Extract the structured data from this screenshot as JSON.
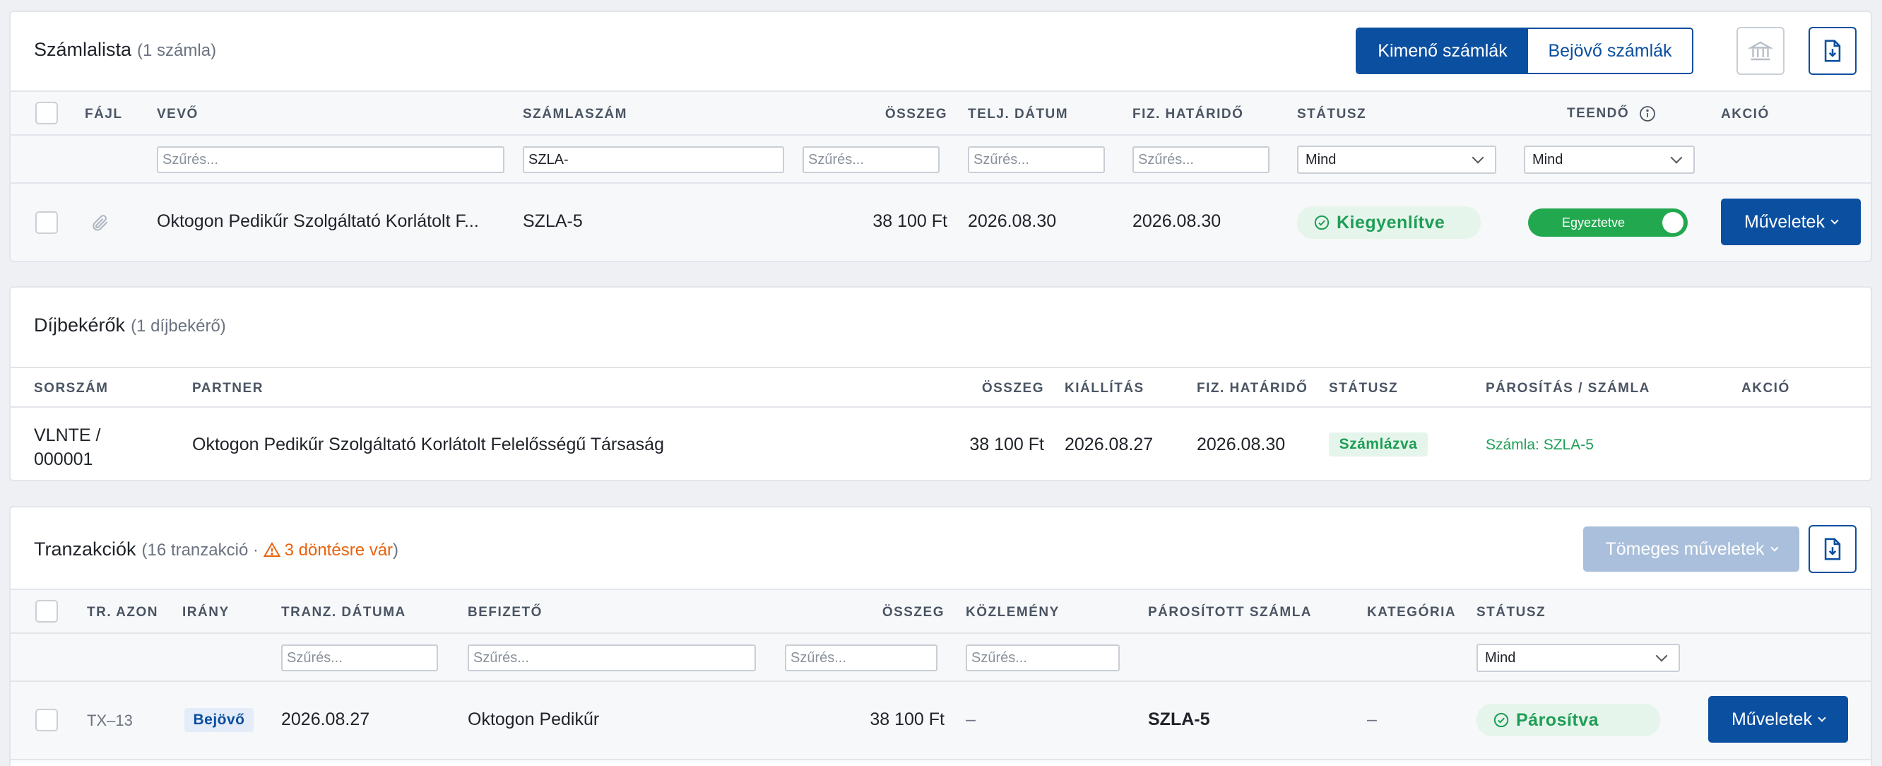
{
  "invoices": {
    "title": "Számlalista",
    "count": "(1 számla)",
    "tabs": {
      "outgoing": "Kimenő számlák",
      "incoming": "Bejövő számlák"
    },
    "headers": {
      "file": "Fájl",
      "buyer": "Vevő",
      "number": "Számlaszám",
      "amount": "Összeg",
      "perf_date": "Telj. dátum",
      "due_date": "Fiz. határidő",
      "status": "Státusz",
      "todo": "Teendő",
      "action": "Akció"
    },
    "filters": {
      "placeholder": "Szűrés...",
      "number_value": "SZLA-",
      "status_select": "Mind",
      "todo_select": "Mind"
    },
    "rows": [
      {
        "buyer": "Oktogon Pedikűr Szolgáltató Korlátolt F...",
        "number": "SZLA-5",
        "amount": "38 100 Ft",
        "perf_date": "2026.08.30",
        "due_date": "2026.08.30",
        "status": "Kiegyenlítve",
        "todo": "Egyeztetve",
        "action": "Műveletek"
      }
    ]
  },
  "proformas": {
    "title": "Díjbekérők",
    "count": "(1 díjbekérő)",
    "headers": {
      "serial": "Sorszám",
      "partner": "Partner",
      "amount": "Összeg",
      "issued": "Kiállítás",
      "due_date": "Fiz. határidő",
      "status": "Státusz",
      "pairing": "Párosítás / számla",
      "action": "Akció"
    },
    "rows": [
      {
        "serial_line1": "VLNTE /",
        "serial_line2": "000001",
        "partner": "Oktogon Pedikűr Szolgáltató Korlátolt Felelősségű Társaság",
        "amount": "38 100 Ft",
        "issued": "2026.08.27",
        "due_date": "2026.08.30",
        "status": "Számlázva",
        "pairing": "Számla: SZLA-5"
      }
    ]
  },
  "transactions": {
    "title": "Tranzakciók",
    "count_prefix": "(16 tranzakció · ",
    "pending": "3 döntésre vár",
    "count_suffix": ")",
    "bulk_button": "Tömeges műveletek",
    "headers": {
      "tr_id": "Tr. azon",
      "direction": "Irány",
      "date": "Tranz. dátuma",
      "payer": "Befizető",
      "amount": "Összeg",
      "note": "Közlemény",
      "matched": "Párosított számla",
      "category": "Kategória",
      "status": "Státusz"
    },
    "filters": {
      "placeholder": "Szűrés...",
      "status_select": "Mind"
    },
    "rows": [
      {
        "tr_id": "TX–13",
        "direction": "Bejövő",
        "date": "2026.08.27",
        "payer": "Oktogon Pedikűr",
        "amount": "38 100 Ft",
        "note": "–",
        "matched": "SZLA-5",
        "category": "–",
        "status": "Párosítva",
        "action": "Műveletek"
      }
    ]
  },
  "colors": {
    "primary": "#0b4fa0",
    "success": "#1e9e55",
    "warning": "#e8620c"
  }
}
